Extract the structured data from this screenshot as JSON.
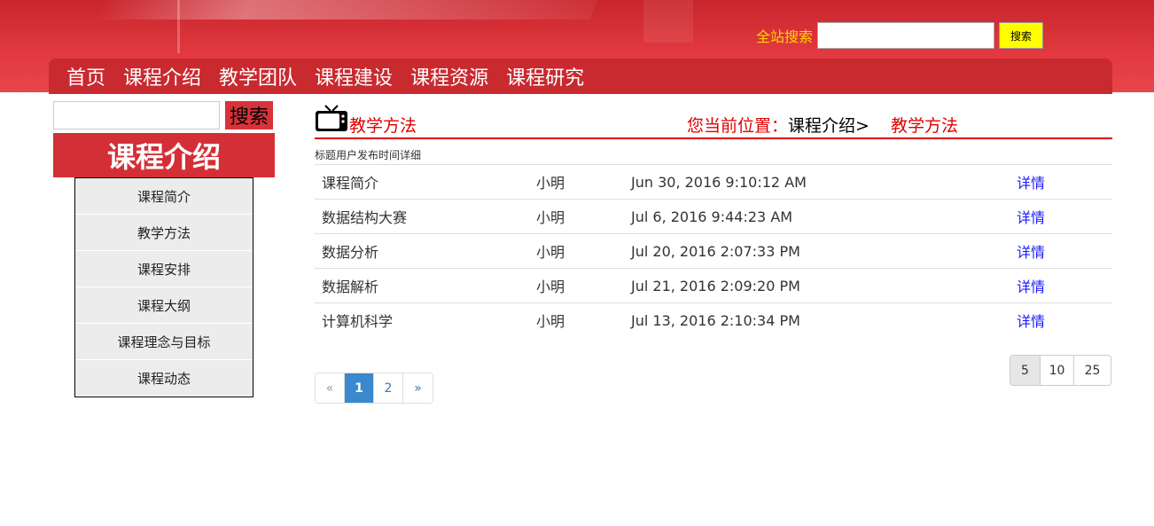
{
  "header": {
    "search_label": "全站搜索",
    "search_value": "",
    "search_button": "搜索"
  },
  "nav": {
    "items": [
      "首页",
      "课程介绍",
      "教学团队",
      "课程建设",
      "课程资源",
      "课程研究"
    ]
  },
  "sidebar": {
    "search_value": "",
    "search_button": "搜索",
    "title": "课程介绍",
    "items": [
      "课程简介",
      "教学方法",
      "课程安排",
      "课程大纲",
      "课程理念与目标",
      "课程动态"
    ]
  },
  "content": {
    "icon": "tv-icon",
    "title": "教学方法",
    "breadcrumb": {
      "prefix": "您当前位置：",
      "parent": "课程介绍>",
      "current": "教学方法"
    },
    "table_header": "标题用户发布时间详细",
    "rows": [
      {
        "title": "课程简介",
        "user": "小明",
        "time": "Jun 30, 2016 9:10:12 AM",
        "detail": "详情"
      },
      {
        "title": "数据结构大赛",
        "user": "小明",
        "time": "Jul 6, 2016 9:44:23 AM",
        "detail": "详情"
      },
      {
        "title": "数据分析",
        "user": "小明",
        "time": "Jul 20, 2016 2:07:33 PM",
        "detail": "详情"
      },
      {
        "title": "数据解析",
        "user": "小明",
        "time": "Jul 21, 2016 2:09:20 PM",
        "detail": "详情"
      },
      {
        "title": "计算机科学",
        "user": "小明",
        "time": "Jul 13, 2016 2:10:34 PM",
        "detail": "详情"
      }
    ]
  },
  "pagination": {
    "prev": "«",
    "pages": [
      "1",
      "2"
    ],
    "active": "1",
    "next": "»"
  },
  "page_size": {
    "options": [
      "5",
      "10",
      "25"
    ],
    "selected": "5"
  },
  "colors": {
    "brand_red": "#d42f36",
    "nav_red": "#c92a2f",
    "link_blue": "#1a1aff",
    "search_yellow": "#ffff00",
    "label_yellow": "#ffd200"
  }
}
